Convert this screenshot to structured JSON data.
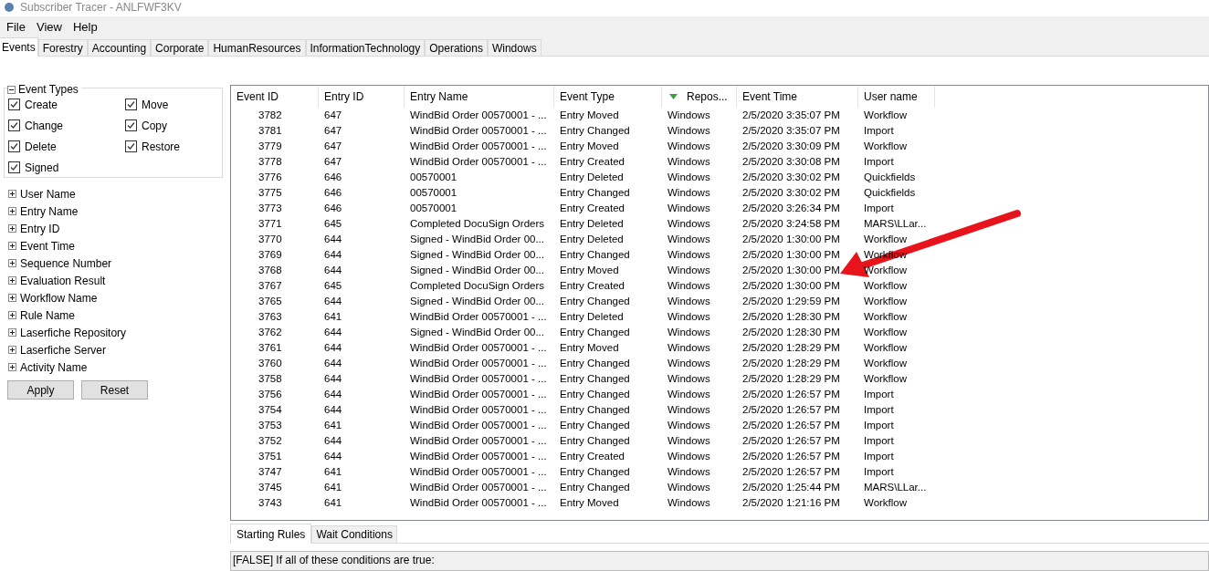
{
  "window": {
    "title": "Subscriber Tracer - ANLFWF3KV"
  },
  "menu": [
    "File",
    "View",
    "Help"
  ],
  "tabs": [
    {
      "label": "Events",
      "selected": true
    },
    {
      "label": "Forestry",
      "selected": false
    },
    {
      "label": "Accounting",
      "selected": false
    },
    {
      "label": "Corporate",
      "selected": false
    },
    {
      "label": "HumanResources",
      "selected": false
    },
    {
      "label": "InformationTechnology",
      "selected": false
    },
    {
      "label": "Operations",
      "selected": false
    },
    {
      "label": "Windows",
      "selected": false
    }
  ],
  "event_types": {
    "title": "Event Types",
    "expanded": true,
    "options": [
      {
        "label": "Create",
        "checked": true
      },
      {
        "label": "Move",
        "checked": true
      },
      {
        "label": "Change",
        "checked": true
      },
      {
        "label": "Copy",
        "checked": true
      },
      {
        "label": "Delete",
        "checked": true
      },
      {
        "label": "Restore",
        "checked": true
      },
      {
        "label": "Signed",
        "checked": true
      }
    ]
  },
  "filters": [
    {
      "label": "User Name",
      "expanded": false
    },
    {
      "label": "Entry Name",
      "expanded": false
    },
    {
      "label": "Entry ID",
      "expanded": false
    },
    {
      "label": "Event Time",
      "expanded": false
    },
    {
      "label": "Sequence Number",
      "expanded": false
    },
    {
      "label": "Evaluation Result",
      "expanded": false
    },
    {
      "label": "Workflow Name",
      "expanded": false
    },
    {
      "label": "Rule Name",
      "expanded": false
    },
    {
      "label": "Laserfiche Repository",
      "expanded": false
    },
    {
      "label": "Laserfiche Server",
      "expanded": false
    },
    {
      "label": "Activity Name",
      "expanded": false
    }
  ],
  "buttons": [
    "Apply",
    "Reset"
  ],
  "table": {
    "columns": [
      {
        "label": "Event ID",
        "sorted": false
      },
      {
        "label": "Entry ID",
        "sorted": false
      },
      {
        "label": "Entry Name",
        "sorted": false
      },
      {
        "label": "Event Type",
        "sorted": false
      },
      {
        "label": "Repos...",
        "sorted": true
      },
      {
        "label": "Event Time",
        "sorted": false
      },
      {
        "label": "User name",
        "sorted": false
      }
    ],
    "rows": [
      [
        "3782",
        "647",
        "WindBid Order 00570001 - ...",
        "Entry Moved",
        "Windows",
        "2/5/2020 3:35:07 PM",
        "Workflow"
      ],
      [
        "3781",
        "647",
        "WindBid Order 00570001 - ...",
        "Entry Changed",
        "Windows",
        "2/5/2020 3:35:07 PM",
        "Import"
      ],
      [
        "3779",
        "647",
        "WindBid Order 00570001 - ...",
        "Entry Moved",
        "Windows",
        "2/5/2020 3:30:09 PM",
        "Workflow"
      ],
      [
        "3778",
        "647",
        "WindBid Order 00570001 - ...",
        "Entry Created",
        "Windows",
        "2/5/2020 3:30:08 PM",
        "Import"
      ],
      [
        "3776",
        "646",
        "00570001",
        "Entry Deleted",
        "Windows",
        "2/5/2020 3:30:02 PM",
        "Quickfields"
      ],
      [
        "3775",
        "646",
        "00570001",
        "Entry Changed",
        "Windows",
        "2/5/2020 3:30:02 PM",
        "Quickfields"
      ],
      [
        "3773",
        "646",
        "00570001",
        "Entry Created",
        "Windows",
        "2/5/2020 3:26:34 PM",
        "Import"
      ],
      [
        "3771",
        "645",
        "Completed DocuSign Orders",
        "Entry Deleted",
        "Windows",
        "2/5/2020 3:24:58 PM",
        "MARS\\LLar..."
      ],
      [
        "3770",
        "644",
        "Signed - WindBid Order 00...",
        "Entry Deleted",
        "Windows",
        "2/5/2020 1:30:00 PM",
        "Workflow"
      ],
      [
        "3769",
        "644",
        "Signed - WindBid Order 00...",
        "Entry Changed",
        "Windows",
        "2/5/2020 1:30:00 PM",
        "Workflow"
      ],
      [
        "3768",
        "644",
        "Signed - WindBid Order 00...",
        "Entry Moved",
        "Windows",
        "2/5/2020 1:30:00 PM",
        "Workflow"
      ],
      [
        "3767",
        "645",
        "Completed DocuSign Orders",
        "Entry Created",
        "Windows",
        "2/5/2020 1:30:00 PM",
        "Workflow"
      ],
      [
        "3765",
        "644",
        "Signed - WindBid Order 00...",
        "Entry Changed",
        "Windows",
        "2/5/2020 1:29:59 PM",
        "Workflow"
      ],
      [
        "3763",
        "641",
        "WindBid Order 00570001 - ...",
        "Entry Deleted",
        "Windows",
        "2/5/2020 1:28:30 PM",
        "Workflow"
      ],
      [
        "3762",
        "644",
        "Signed - WindBid Order 00...",
        "Entry Changed",
        "Windows",
        "2/5/2020 1:28:30 PM",
        "Workflow"
      ],
      [
        "3761",
        "644",
        "WindBid Order 00570001 - ...",
        "Entry Moved",
        "Windows",
        "2/5/2020 1:28:29 PM",
        "Workflow"
      ],
      [
        "3760",
        "644",
        "WindBid Order 00570001 - ...",
        "Entry Changed",
        "Windows",
        "2/5/2020 1:28:29 PM",
        "Workflow"
      ],
      [
        "3758",
        "644",
        "WindBid Order 00570001 - ...",
        "Entry Changed",
        "Windows",
        "2/5/2020 1:28:29 PM",
        "Workflow"
      ],
      [
        "3756",
        "644",
        "WindBid Order 00570001 - ...",
        "Entry Changed",
        "Windows",
        "2/5/2020 1:26:57 PM",
        "Import"
      ],
      [
        "3754",
        "644",
        "WindBid Order 00570001 - ...",
        "Entry Changed",
        "Windows",
        "2/5/2020 1:26:57 PM",
        "Import"
      ],
      [
        "3753",
        "641",
        "WindBid Order 00570001 - ...",
        "Entry Changed",
        "Windows",
        "2/5/2020 1:26:57 PM",
        "Import"
      ],
      [
        "3752",
        "644",
        "WindBid Order 00570001 - ...",
        "Entry Changed",
        "Windows",
        "2/5/2020 1:26:57 PM",
        "Import"
      ],
      [
        "3751",
        "644",
        "WindBid Order 00570001 - ...",
        "Entry Created",
        "Windows",
        "2/5/2020 1:26:57 PM",
        "Import"
      ],
      [
        "3747",
        "641",
        "WindBid Order 00570001 - ...",
        "Entry Changed",
        "Windows",
        "2/5/2020 1:26:57 PM",
        "Import"
      ],
      [
        "3745",
        "641",
        "WindBid Order 00570001 - ...",
        "Entry Changed",
        "Windows",
        "2/5/2020 1:25:44 PM",
        "MARS\\LLar..."
      ],
      [
        "3743",
        "641",
        "WindBid Order 00570001 - ...",
        "Entry Moved",
        "Windows",
        "2/5/2020 1:21:16 PM",
        "Workflow"
      ]
    ]
  },
  "bottom_tabs": [
    {
      "label": "Starting Rules",
      "selected": true
    },
    {
      "label": "Wait Conditions",
      "selected": false
    }
  ],
  "rules_text": "[FALSE] If all of these conditions are true:"
}
